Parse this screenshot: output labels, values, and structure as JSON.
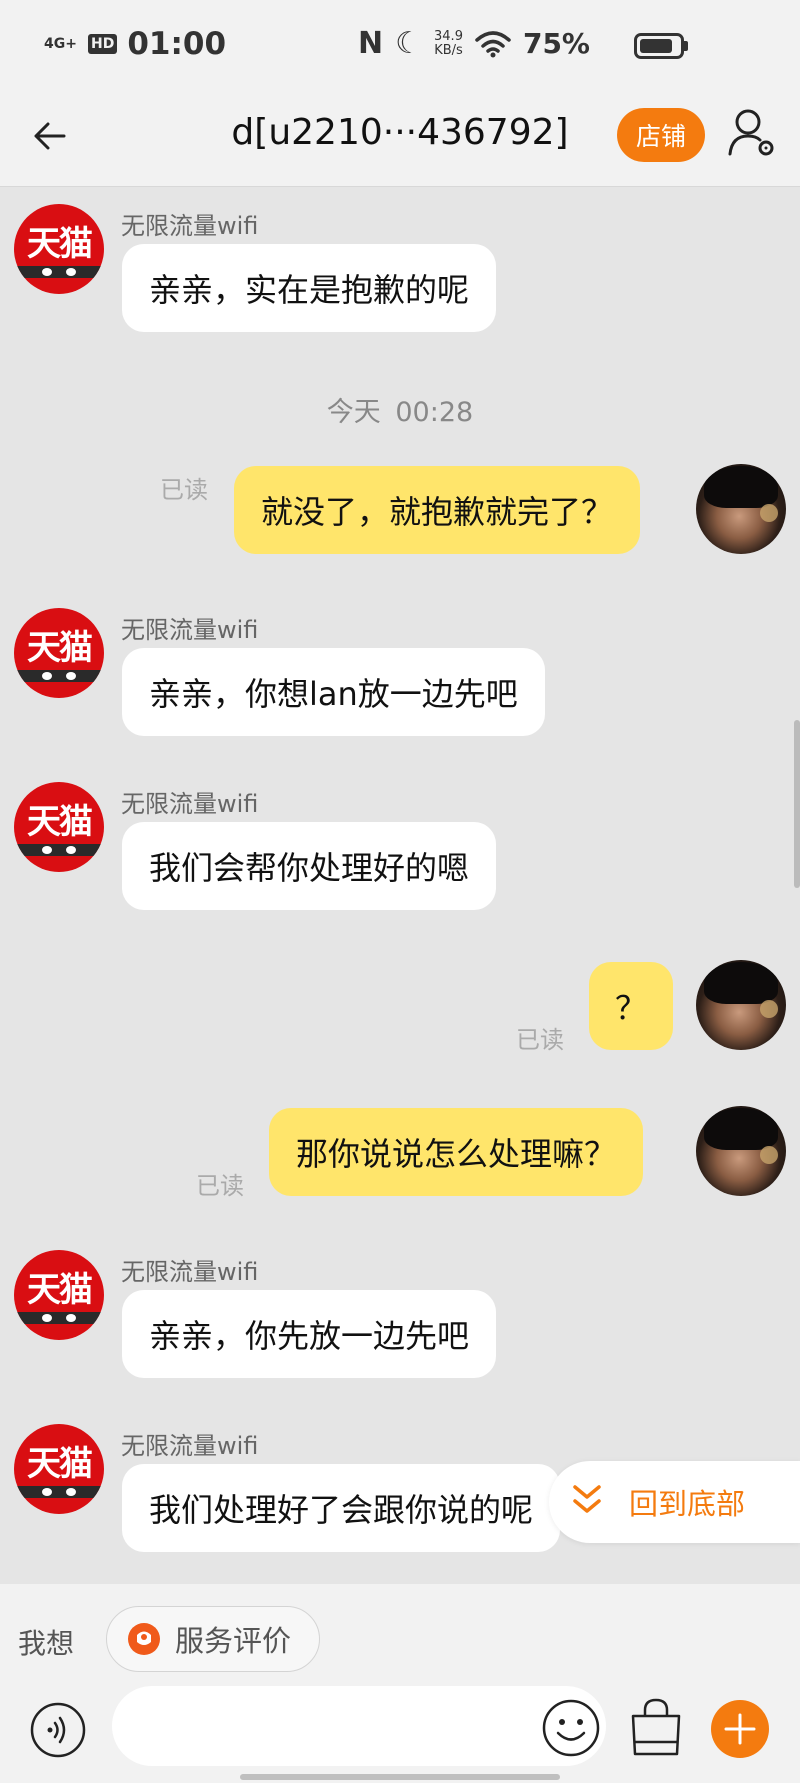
{
  "status_bar": {
    "network": "4G+",
    "hd": "HD",
    "time": "01:00",
    "nfc": "N",
    "speed_value": "34.9",
    "speed_unit": "KB/s",
    "battery": "75%"
  },
  "header": {
    "title": "d[u2210···436792]",
    "shop_button": "店铺"
  },
  "messages": [
    {
      "sender": "无限流量wifi",
      "text": "亲亲，实在是抱歉的呢"
    },
    {
      "timestamp": "今天  00:28"
    },
    {
      "text": "就没了，就抱歉就完了？",
      "read": "已读"
    },
    {
      "sender": "无限流量wifi",
      "text": "亲亲，你想lan放一边先吧"
    },
    {
      "sender": "无限流量wifi",
      "text": "我们会帮你处理好的嗯"
    },
    {
      "text": "？",
      "read": "已读"
    },
    {
      "text": "那你说说怎么处理嘛？",
      "read": "已读"
    },
    {
      "sender": "无限流量wifi",
      "text": "亲亲，你先放一边先吧"
    },
    {
      "sender": "无限流量wifi",
      "text": "我们处理好了会跟你说的呢"
    }
  ],
  "tmall_avatar_text": "天猫",
  "back_to_bottom": "回到底部",
  "quick_bar": {
    "label": "我想",
    "chip": "服务评价"
  },
  "input": {
    "placeholder": ""
  },
  "colors": {
    "accent": "#f47b0f",
    "outgoing_bubble": "#ffe56b",
    "tmall_red": "#d90e12",
    "chat_background": "#e5e5e5"
  },
  "icons": [
    "back-arrow-icon",
    "user-settings-icon",
    "chevron-double-down-icon",
    "voice-icon",
    "emoji-icon",
    "shopping-bag-icon",
    "plus-icon",
    "service-rating-icon"
  ]
}
